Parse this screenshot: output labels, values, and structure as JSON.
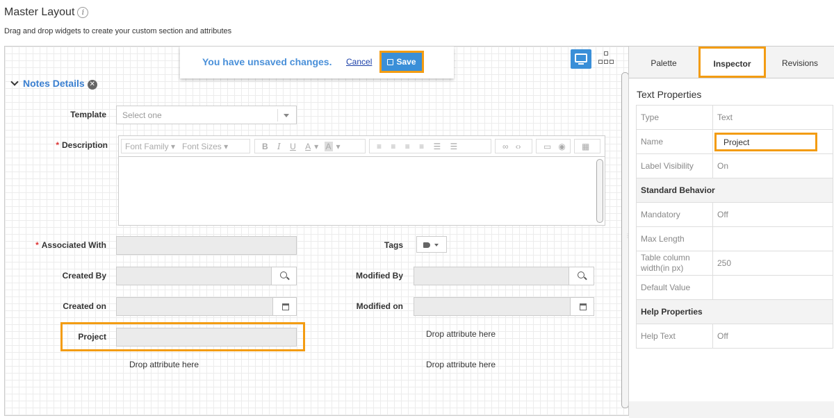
{
  "header": {
    "title": "Master Layout",
    "info_icon": "i",
    "subtitle": "Drag and drop widgets to create your custom section and attributes"
  },
  "unsaved": {
    "message": "You have unsaved changes.",
    "cancel_label": "Cancel",
    "save_label": "Save"
  },
  "view_toggle": {
    "desktop_icon": "desktop-icon",
    "tree_icon": "tree-icon"
  },
  "section": {
    "title": "Notes Details"
  },
  "form": {
    "template_label": "Template",
    "template_placeholder": "Select one",
    "description_label": "Description",
    "required_mark": "*",
    "editor_toolbar": {
      "font_family": "Font Family",
      "font_sizes": "Font Sizes",
      "bold": "B",
      "italic": "I",
      "underline": "U",
      "font_color": "A",
      "bg_color": "A"
    },
    "associated_label": "Associated With",
    "tags_label": "Tags",
    "created_by_label": "Created By",
    "modified_by_label": "Modified By",
    "created_on_label": "Created on",
    "modified_on_label": "Modified on",
    "project_label": "Project",
    "drop_hint": "Drop attribute here"
  },
  "panel": {
    "tabs": [
      {
        "label": "Palette"
      },
      {
        "label": "Inspector",
        "active": true
      },
      {
        "label": "Revisions"
      }
    ],
    "props_title": "Text Properties",
    "rows": [
      {
        "key": "Type",
        "value": "Text"
      },
      {
        "key": "Name",
        "value": "Project"
      },
      {
        "key": "Label Visibility",
        "value": "On"
      },
      {
        "section": "Standard Behavior"
      },
      {
        "key": "Mandatory",
        "value": "Off"
      },
      {
        "key": "Max Length",
        "value": ""
      },
      {
        "key": "Table column width(in px)",
        "value": "250"
      },
      {
        "key": "Default Value",
        "value": ""
      },
      {
        "section": "Help Properties"
      },
      {
        "key": "Help Text",
        "value": "Off"
      }
    ]
  },
  "colors": {
    "accent": "#3a8fd8",
    "highlight": "#f39c12",
    "link": "#1a3fa8"
  }
}
